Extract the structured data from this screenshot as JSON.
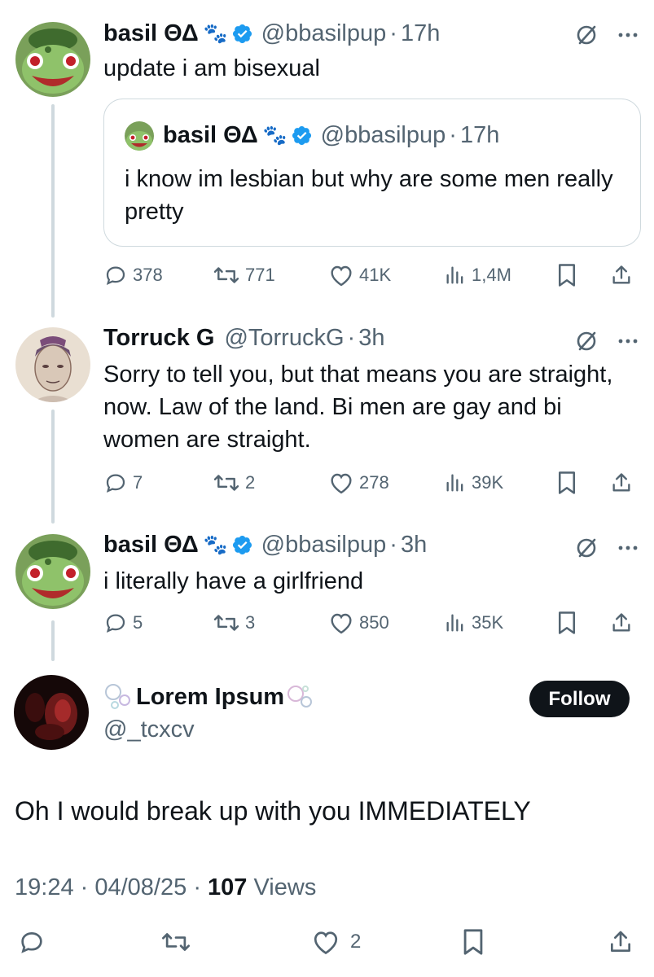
{
  "tweets": [
    {
      "name": "basil ΘΔ",
      "emoji": "🐾",
      "handle": "@bbasilpup",
      "time": "17h",
      "text": "update i am bisexual",
      "quote": {
        "name": "basil ΘΔ",
        "emoji": "🐾",
        "handle": "@bbasilpup",
        "time": "17h",
        "text": "i know im lesbian but why are some men really pretty"
      },
      "replies": "378",
      "retweets": "771",
      "likes": "41K",
      "views": "1,4M"
    },
    {
      "name": "Torruck G",
      "handle": "@TorruckG",
      "time": "3h",
      "text": "Sorry to tell you, but that means you are straight, now. Law of the land. Bi men are gay and bi women are straight.",
      "replies": "7",
      "retweets": "2",
      "likes": "278",
      "views": "39K"
    },
    {
      "name": "basil ΘΔ",
      "emoji": "🐾",
      "handle": "@bbasilpup",
      "time": "3h",
      "text": "i literally have a girlfriend",
      "replies": "5",
      "retweets": "3",
      "likes": "850",
      "views": "35K"
    }
  ],
  "main_tweet": {
    "name": "Lorem Ipsum",
    "handle": "@_tcxcv",
    "follow_label": "Follow",
    "text": "Oh I would break up with you IMMEDIATELY",
    "time": "19:24",
    "date": "04/08/25",
    "views_count": "107",
    "views_label": "Views",
    "likes": "2"
  },
  "colors": {
    "text": "#0f1419",
    "secondary": "#536471",
    "verified": "#1d9bf0",
    "border": "#cfd9de"
  }
}
